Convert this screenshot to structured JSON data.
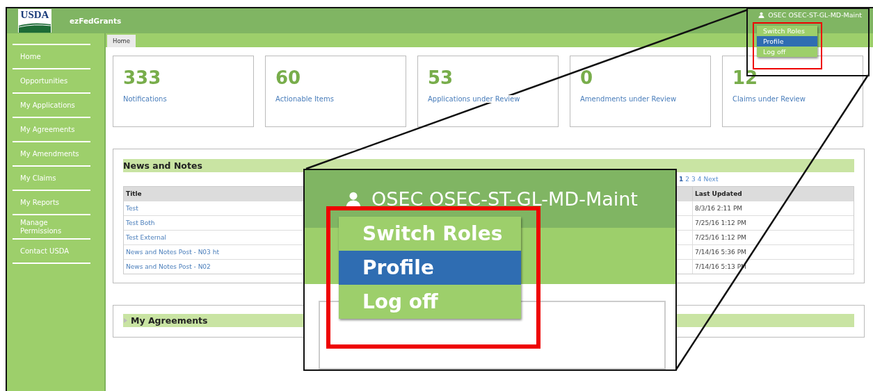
{
  "header": {
    "logo": "USDA",
    "app_name": "ezFedGrants",
    "user": "OSEC OSEC-ST-GL-MD-Maint",
    "user_menu": [
      {
        "label": "Switch Roles",
        "selected": false
      },
      {
        "label": "Profile",
        "selected": true
      },
      {
        "label": "Log off",
        "selected": false
      }
    ]
  },
  "sidebar": {
    "items": [
      {
        "label": "Home"
      },
      {
        "label": "Opportunities"
      },
      {
        "label": "My Applications"
      },
      {
        "label": "My Agreements"
      },
      {
        "label": "My Amendments"
      },
      {
        "label": "My Claims"
      },
      {
        "label": "My Reports"
      },
      {
        "label": "Manage Permissions"
      },
      {
        "label": "Contact USDA"
      }
    ]
  },
  "tabs": [
    {
      "label": "Home",
      "selected": true
    }
  ],
  "cards": [
    {
      "value": "333",
      "label": "Notifications"
    },
    {
      "value": "60",
      "label": "Actionable Items"
    },
    {
      "value": "53",
      "label": "Applications under Review"
    },
    {
      "value": "0",
      "label": "Amendments under Review"
    },
    {
      "value": "12",
      "label": "Claims under Review"
    }
  ],
  "news": {
    "title": "News and Notes",
    "pagination": [
      {
        "label": "1",
        "selected": true
      },
      {
        "label": "2",
        "selected": false
      },
      {
        "label": "3",
        "selected": false
      },
      {
        "label": "4",
        "selected": false
      },
      {
        "label": "Next",
        "selected": false
      }
    ],
    "columns": [
      "Title",
      "Last Updated"
    ],
    "rows": [
      {
        "title": "Test",
        "updated": "8/3/16 2:11 PM"
      },
      {
        "title": "Test Both",
        "updated": "7/25/16 1:12 PM"
      },
      {
        "title": "Test External",
        "updated": "7/25/16 1:12 PM"
      },
      {
        "title": "News and Notes Post - N03 ht",
        "updated": "7/14/16 5:36 PM"
      },
      {
        "title": "News and Notes Post - N02",
        "updated": "7/14/16 5:13 PM"
      }
    ]
  },
  "agreements": {
    "title": "My Agreements",
    "expanded": false
  },
  "inset": {
    "user": "OSEC OSEC-ST-GL-MD-Maint",
    "menu": [
      {
        "label": "Switch Roles",
        "selected": false
      },
      {
        "label": "Profile",
        "selected": true
      },
      {
        "label": "Log off",
        "selected": false
      }
    ]
  }
}
